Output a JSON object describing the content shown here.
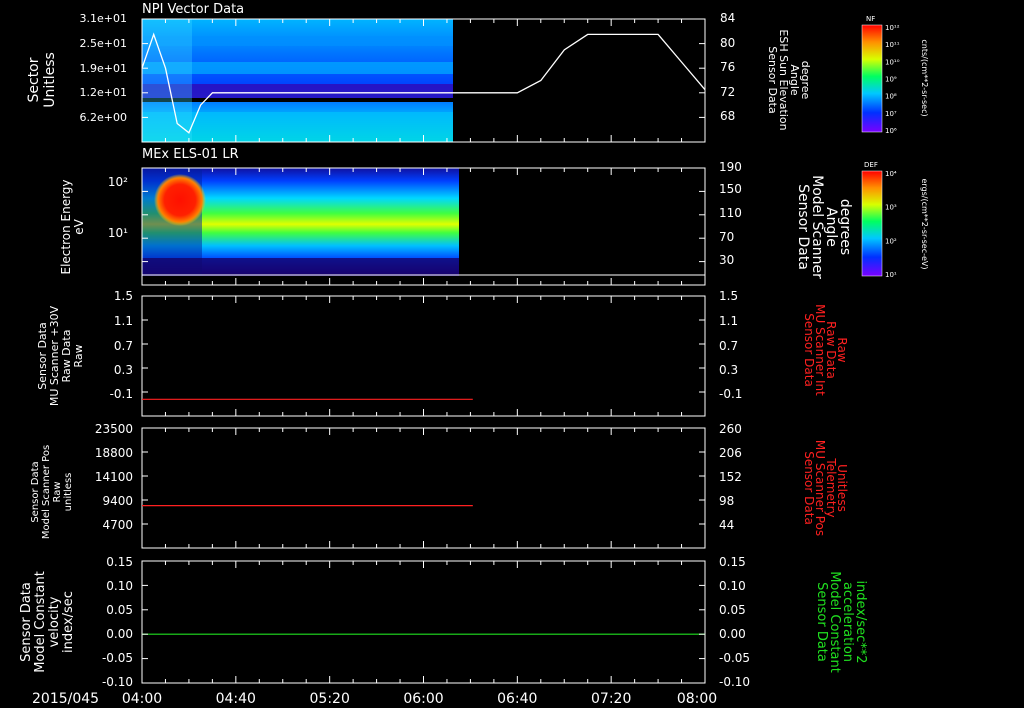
{
  "date_label": "2015/045",
  "x_ticks": [
    "04:00",
    "04:40",
    "05:20",
    "06:00",
    "06:40",
    "07:20",
    "08:00"
  ],
  "colors": {
    "red": "#ff2020",
    "green": "#20e020",
    "white": "#ffffff"
  },
  "panels": [
    {
      "id": "npi",
      "title": "NPI Vector Data",
      "left_label": [
        "Sector",
        "Unitless"
      ],
      "left_ticks": [
        "3.1e+01",
        "2.5e+01",
        "1.9e+01",
        "1.2e+01",
        "6.2e+00"
      ],
      "right_label": [
        "Sensor Data",
        "ESH Sun Elevation",
        "Angle",
        "degree"
      ],
      "right_ticks": [
        "84",
        "80",
        "76",
        "72",
        "68"
      ],
      "colorbar": {
        "label": "NF",
        "units": "cnts/(cm**2-sr-sec)",
        "ticks": [
          "10¹²",
          "10¹¹",
          "10¹⁰",
          "10⁹",
          "10⁸",
          "10⁷",
          "10⁶"
        ]
      }
    },
    {
      "id": "els",
      "title": "MEx ELS-01 LR",
      "left_label": [
        "Electron Energy",
        "eV"
      ],
      "left_ticks": [
        "10²",
        "10¹"
      ],
      "right_label": [
        "Sensor Data",
        "Model Scanner",
        "Angle",
        "degrees"
      ],
      "right_ticks": [
        "190",
        "150",
        "110",
        "70",
        "30"
      ],
      "colorbar": {
        "label": "DEF",
        "units": "ergs/(cm**2-sr-sec-eV)",
        "ticks": [
          "10⁴",
          "10³",
          "10²",
          "10¹"
        ]
      }
    },
    {
      "id": "mu30",
      "left_label": [
        "Sensor Data",
        "MU Scanner +30V",
        "Raw Data",
        "Raw"
      ],
      "left_ticks": [
        "1.5",
        "1.1",
        "0.7",
        "0.3",
        "-0.1"
      ],
      "right_label": [
        "Sensor Data",
        "MU Scanner Int",
        "Raw Data",
        "Raw"
      ],
      "right_ticks": [
        "1.5",
        "1.1",
        "0.7",
        "0.3",
        "-0.1"
      ]
    },
    {
      "id": "pos",
      "left_label": [
        "Sensor Data",
        "Model Scanner Pos",
        "Raw",
        "unitless"
      ],
      "left_ticks": [
        "23500",
        "18800",
        "14100",
        "9400",
        "4700"
      ],
      "right_label": [
        "Sensor Data",
        "MU Scanner Pos",
        "Telemetry",
        "Unitless"
      ],
      "right_ticks": [
        "260",
        "206",
        "152",
        "98",
        "44"
      ]
    },
    {
      "id": "vel",
      "left_label": [
        "Sensor Data",
        "Model Constant",
        "velocity",
        "index/sec"
      ],
      "left_ticks": [
        "0.15",
        "0.10",
        "0.05",
        "0.00",
        "-0.05",
        "-0.10"
      ],
      "right_label": [
        "Sensor Data",
        "Model Constant",
        "acceleration",
        "index/sec**2"
      ],
      "right_ticks": [
        "0.15",
        "0.10",
        "0.05",
        "0.00",
        "-0.05",
        "-0.10"
      ]
    }
  ],
  "chart_data": [
    {
      "type": "heatmap",
      "title": "NPI Vector Data",
      "x_range": [
        "04:00",
        "08:00"
      ],
      "data_end": "06:15",
      "ylabel": "Sector Unitless",
      "ylim": [
        0,
        31
      ],
      "colorbar_label": "NF",
      "overlay_line": {
        "name": "Sensor Data ESH Sun Elevation Angle",
        "ylim": [
          64,
          84
        ],
        "x": [
          "04:00",
          "04:05",
          "04:10",
          "04:15",
          "04:20",
          "04:25",
          "04:30",
          "06:40",
          "06:50",
          "07:00",
          "07:10",
          "07:30",
          "07:40",
          "07:50",
          "08:00"
        ],
        "y": [
          76,
          81.5,
          76,
          67,
          65.5,
          70,
          72,
          72,
          74,
          79,
          81.5,
          81.5,
          81.5,
          77,
          72.5
        ]
      }
    },
    {
      "type": "heatmap",
      "title": "MEx ELS-01 LR",
      "x_range": [
        "04:00",
        "08:00"
      ],
      "data_end": "06:16",
      "ylabel": "Electron Energy eV",
      "yscale": "log",
      "colorbar_label": "DEF",
      "overlay_line": {
        "name": "Sensor Data Model Scanner Angle",
        "ylim": [
          10,
          190
        ],
        "x": [
          "04:00",
          "08:00"
        ],
        "y": [
          10,
          10
        ]
      }
    },
    {
      "type": "line",
      "x_range": [
        "04:00",
        "08:00"
      ],
      "ylim": [
        -0.3,
        1.5
      ],
      "series": [
        {
          "name": "Sensor Data MU Scanner +30V Raw Data",
          "x": [
            "04:00",
            "06:21"
          ],
          "y": [
            -0.05,
            -0.05
          ],
          "color": "#ff2020"
        }
      ]
    },
    {
      "type": "line",
      "x_range": [
        "04:00",
        "08:00"
      ],
      "ylim": [
        0,
        23500
      ],
      "series": [
        {
          "name": "Sensor Data Model Scanner Pos Raw",
          "x": [
            "04:00",
            "06:21"
          ],
          "y": [
            8300,
            8300
          ],
          "color": "#ff2020"
        }
      ]
    },
    {
      "type": "line",
      "x_range": [
        "04:00",
        "08:00"
      ],
      "ylim": [
        -0.1,
        0.15
      ],
      "series": [
        {
          "name": "Sensor Data Model Constant velocity",
          "x": [
            "04:00",
            "08:00"
          ],
          "y": [
            0.0,
            0.0
          ],
          "color": "#20e020"
        }
      ]
    }
  ]
}
